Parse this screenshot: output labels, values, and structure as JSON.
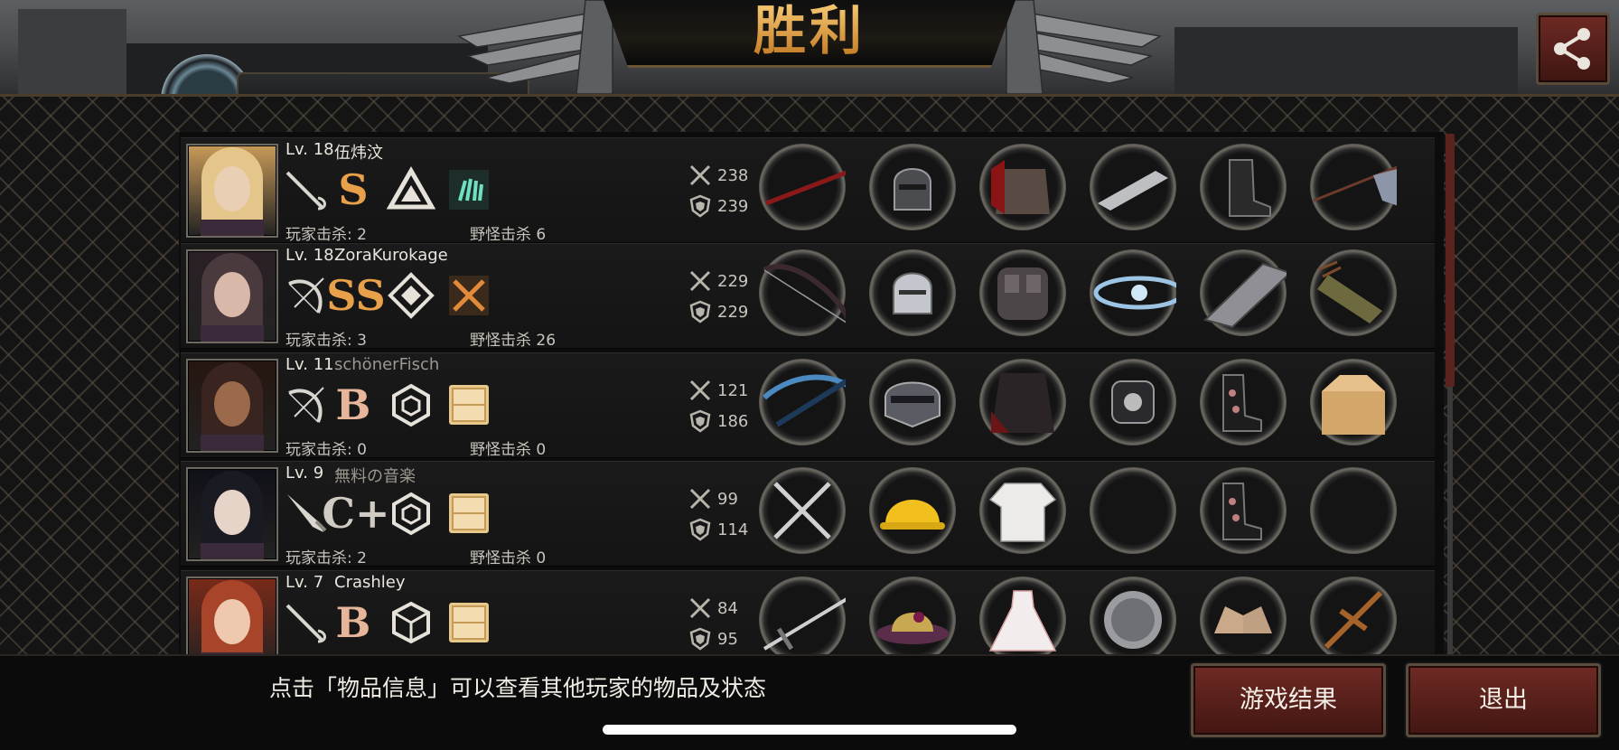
{
  "header": {
    "title": "胜利",
    "background_name_partial": "伍炜汶",
    "share_label": ""
  },
  "players": [
    {
      "level": "Lv. 18",
      "name": "伍炜汶",
      "name_dim": false,
      "weapon_icon": "rapier-icon",
      "grade": "S",
      "grade_color": "#e8a04a",
      "class_icon": "triangle-class-icon",
      "item_icon": "green-hand-icon",
      "player_kills": "玩家击杀: 2",
      "monster_kills": "野怪击杀 6",
      "attack": "238",
      "defense": "239",
      "equipment": [
        "crimson-spear-icon",
        "knight-helmet-icon",
        "red-plate-armor-icon",
        "steel-gauntlet-icon",
        "leather-boots-icon",
        "banner-flag-icon"
      ]
    },
    {
      "level": "Lv. 18",
      "name": "ZoraKurokage",
      "name_dim": false,
      "weapon_icon": "bow-icon",
      "grade": "SS",
      "grade_color": "#e8a04a",
      "class_icon": "diamond-class-icon",
      "item_icon": "crossed-swords-item-icon",
      "player_kills": "玩家击杀: 3",
      "monster_kills": "野怪击杀 26",
      "attack": "229",
      "defense": "229",
      "equipment": [
        "dark-bow-icon",
        "silver-helmet-icon",
        "stone-armor-icon",
        "crystal-circlet-icon",
        "chain-gauntlet-icon",
        "quiver-icon"
      ]
    },
    {
      "level": "Lv. 11",
      "name": "schönerFisch",
      "name_dim": true,
      "weapon_icon": "bow-icon",
      "grade": "B",
      "grade_color": "#e7b59a",
      "class_icon": "hexagon-class-icon",
      "item_icon": "box-item-icon",
      "player_kills": "玩家击杀: 0",
      "monster_kills": "野怪击杀 0",
      "attack": "121",
      "defense": "186",
      "equipment": [
        "blue-crossbow-icon",
        "visor-helmet-icon",
        "dark-coat-icon",
        "gauntlet-watch-icon",
        "floral-boots-icon",
        "cardboard-box-icon"
      ]
    },
    {
      "level": "Lv. 9",
      "name": "無料の音楽",
      "name_dim": true,
      "weapon_icon": "knife-icon",
      "grade": "C+",
      "grade_color": "#cfcac2",
      "class_icon": "hexagon-class-icon",
      "item_icon": "box-item-icon",
      "player_kills": "玩家击杀: 2",
      "monster_kills": "野怪击杀 0",
      "attack": "99",
      "defense": "114",
      "equipment": [
        "crossed-knives-icon",
        "hard-hat-icon",
        "white-shirt-icon",
        "empty-slot",
        "floral-boots-icon",
        "empty-slot"
      ]
    },
    {
      "level": "Lv. 7",
      "name": "Crashley",
      "name_dim": false,
      "weapon_icon": "rapier-icon",
      "grade": "B",
      "grade_color": "#e7b59a",
      "class_icon": "cube-class-icon",
      "item_icon": "box-item-icon",
      "player_kills": "",
      "monster_kills": "",
      "attack": "84",
      "defense": "95",
      "equipment": [
        "long-sword-icon",
        "flower-hat-icon",
        "white-dress-icon",
        "round-shield-icon",
        "sandals-icon",
        "wooden-cross-icon"
      ]
    }
  ],
  "footer": {
    "hint": "点击「物品信息」可以查看其他玩家的物品及状态",
    "results_label": "游戏结果",
    "exit_label": "退出"
  },
  "colors": {
    "accent_gold": "#d89a3a",
    "button_red": "#6e2a24",
    "frame_bronze": "#5b4d3e"
  }
}
